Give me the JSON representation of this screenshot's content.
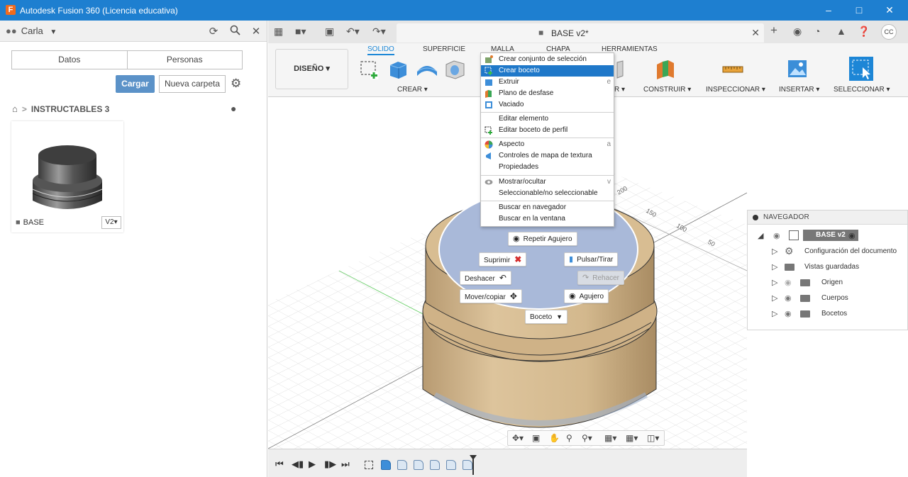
{
  "window": {
    "title": "Autodesk Fusion 360 (Licencia educativa)",
    "app_icon": "F"
  },
  "datapanel": {
    "user": "Carla",
    "tabs": [
      "Datos",
      "Personas"
    ],
    "upload_label": "Cargar",
    "new_folder_label": "Nueva carpeta",
    "breadcrumb": "INSTRUCTABLES 3",
    "file": {
      "name": "BASE",
      "version": "V2▾"
    }
  },
  "document": {
    "title": "BASE v2*"
  },
  "ribbon": {
    "workspace": "DISEÑO ▾",
    "tabs": [
      "SOLIDO",
      "SUPERFICIE",
      "MALLA",
      "CHAPA",
      "HERRAMIENTAS"
    ],
    "active_tab": "SOLIDO",
    "groups": {
      "crear": "CREAR ▾",
      "partial": "R ▾",
      "construir": "CONSTRUIR ▾",
      "inspeccionar": "INSPECCIONAR ▾",
      "insertar": "INSERTAR ▾",
      "seleccionar": "SELECCIONAR ▾"
    }
  },
  "context_menu": [
    {
      "label": "Crear conjunto de selección",
      "key": ""
    },
    {
      "label": "Crear boceto",
      "key": "",
      "highlighted": true
    },
    {
      "label": "Extruir",
      "key": "e"
    },
    {
      "label": "Plano de desfase",
      "key": ""
    },
    {
      "label": "Vaciado",
      "key": ""
    },
    {
      "label": "Editar elemento",
      "key": ""
    },
    {
      "label": "Editar boceto de perfil",
      "key": ""
    },
    {
      "label": "Aspecto",
      "key": "a"
    },
    {
      "label": "Controles de mapa de textura",
      "key": ""
    },
    {
      "label": "Propiedades",
      "key": ""
    },
    {
      "label": "Mostrar/ocultar",
      "key": "v"
    },
    {
      "label": "Seleccionable/no seleccionable",
      "key": ""
    },
    {
      "label": "Buscar en navegador",
      "key": ""
    },
    {
      "label": "Buscar en la ventana",
      "key": ""
    }
  ],
  "marking_menu": {
    "repeat_hole": "Repetir Agujero",
    "delete": "Suprimir",
    "press_pull": "Pulsar/Tirar",
    "undo": "Deshacer",
    "redo": "Rehacer",
    "move_copy": "Mover/copiar",
    "hole": "Agujero",
    "sketch": "Boceto"
  },
  "navigator": {
    "title": "NAVEGADOR",
    "root": "BASE v2",
    "items": [
      "Configuración del documento",
      "Vistas guardadas",
      "Origen",
      "Cuerpos",
      "Bocetos"
    ]
  },
  "grid_labels": [
    "200",
    "150",
    "100",
    "50"
  ],
  "colors": {
    "title_bar": "#1e7fd0",
    "accent": "#1f78c9",
    "body": "#d4b990",
    "sketch_face": "#a7b8d8"
  }
}
